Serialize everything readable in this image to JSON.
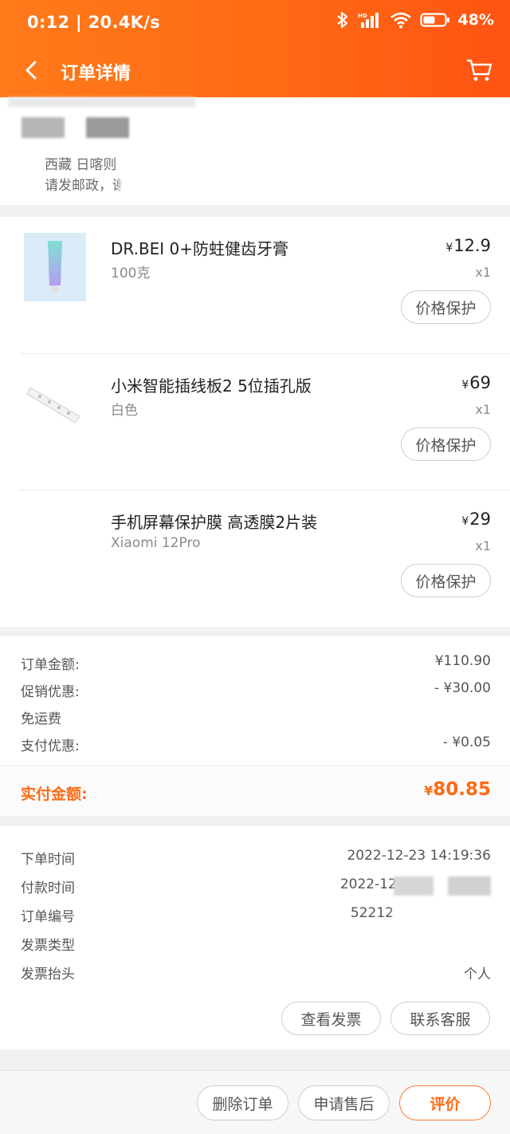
{
  "status_bar": {
    "time": "0:12 | 20.4K/s",
    "battery": "48%",
    "icons": [
      "bluetooth-icon",
      "signal-icon",
      "wifi-icon",
      "battery-icon"
    ]
  },
  "nav": {
    "title": "订单详情",
    "icons": [
      "back-icon",
      "cart-icon"
    ]
  },
  "address": {
    "line1": "西藏 日喀则",
    "line2": "请发邮政，谢"
  },
  "products": [
    {
      "name": "DR.BEI 0+防蛀健齿牙膏",
      "spec": "100克",
      "currency": "¥",
      "price": "12.9",
      "qty": "x1",
      "action": "价格保护"
    },
    {
      "name": "小米智能插线板2 5位插孔版",
      "spec": "白色",
      "currency": "¥",
      "price": "69",
      "qty": "x1",
      "action": "价格保护"
    },
    {
      "name": "手机屏幕保护膜 高透膜2片装",
      "spec": "Xiaomi 12Pro",
      "currency": "¥",
      "price": "29",
      "qty": "x1",
      "action": "价格保护"
    }
  ],
  "summary": {
    "rows": [
      {
        "label": "订单金额:",
        "value": "¥110.90"
      },
      {
        "label": "促销优惠:",
        "value": "- ¥30.00"
      },
      {
        "label": "免运费",
        "value": ""
      },
      {
        "label": "支付优惠:",
        "value": "- ¥0.05"
      }
    ],
    "paid_label": "实付金额:",
    "paid_currency": "¥",
    "paid_value": "80.85"
  },
  "order_info": {
    "rows": [
      {
        "label": "下单时间",
        "value": "2022-12-23 14:19:36"
      },
      {
        "label": "付款时间",
        "value": "2022-12-"
      },
      {
        "label": "订单编号",
        "value": "52212"
      },
      {
        "label": "发票类型",
        "value": ""
      },
      {
        "label": "发票抬头",
        "value": "个人"
      }
    ],
    "view_invoice": "查看发票",
    "contact_service": "联系客服"
  },
  "bottom_bar": {
    "delete_order": "删除订单",
    "after_sales": "申请售后",
    "review": "评价"
  },
  "colors": {
    "accent": "#ff6a14"
  }
}
